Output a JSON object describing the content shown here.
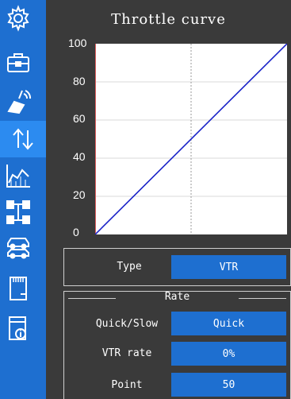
{
  "sidebar": {
    "items": [
      {
        "icon": "gear-icon"
      },
      {
        "icon": "toolbox-icon"
      },
      {
        "icon": "transmitter-icon"
      },
      {
        "icon": "throttle-arrows-icon",
        "active": true
      },
      {
        "icon": "curve-chart-icon"
      },
      {
        "icon": "chassis-icon"
      },
      {
        "icon": "car-swap-icon"
      },
      {
        "icon": "sd-card-icon"
      },
      {
        "icon": "device-info-icon"
      }
    ]
  },
  "page": {
    "title": "Throttle curve"
  },
  "chart_data": {
    "type": "line",
    "ylim": [
      0,
      100
    ],
    "yticks": [
      "100",
      "80",
      "60",
      "40",
      "20",
      "0"
    ],
    "series": [
      {
        "x": [
          0,
          100
        ],
        "values": [
          0,
          100
        ],
        "color": "#1a23c8"
      }
    ],
    "grid": true
  },
  "type_row": {
    "label": "Type",
    "value": "VTR"
  },
  "rate": {
    "title": "Rate",
    "rows": [
      {
        "label": "Quick/Slow",
        "value": "Quick"
      },
      {
        "label": "VTR rate",
        "value": "0%"
      },
      {
        "label": "Point",
        "value": "50"
      }
    ]
  },
  "colors": {
    "sidebar": "#1e6fd0",
    "accent_button": "#1e6fd0",
    "background": "#3a3a3a",
    "curve": "#1a23c8"
  }
}
